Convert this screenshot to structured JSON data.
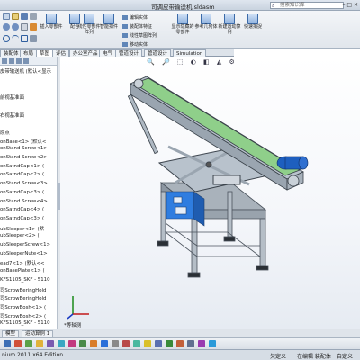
{
  "window": {
    "title": "司调皮带输送机.sldasm",
    "search_placeholder": "搜索知识库",
    "controls": "– □ ✕"
  },
  "ribbon": {
    "big_tools": [
      {
        "label": "插入零部件",
        "name": "insert-components"
      },
      {
        "label": "配合",
        "name": "mate"
      },
      {
        "label": "线性零部件阵列",
        "name": "linear-pattern"
      },
      {
        "label": "智能扣件",
        "name": "smart-fasteners"
      },
      {
        "label": "移动零部件",
        "name": "move-component"
      },
      {
        "label": "显示隐藏的零部件",
        "name": "show-hidden"
      },
      {
        "label": "装配体特征",
        "name": "assembly-features"
      },
      {
        "label": "参考几何体",
        "name": "reference-geometry"
      },
      {
        "label": "新建运动算例",
        "name": "new-motion-study"
      },
      {
        "label": "材料明细表",
        "name": "bill-of-materials"
      },
      {
        "label": "快速捕捉",
        "name": "instant-snap"
      }
    ],
    "small_tools": [
      "编辑实体",
      "装配体特征",
      "线性草图阵列",
      "移动实体"
    ]
  },
  "tabs": [
    "装配体",
    "布局",
    "草图",
    "评估",
    "办公室产品",
    "电气",
    "管道设计",
    "管道设计",
    "Simulation"
  ],
  "active_tab": 2,
  "feature_tree": {
    "items": [
      "皮带输送机 (默认<显示",
      "",
      "",
      "前视基准面",
      "",
      "右视基准面",
      "",
      "原点",
      "onBase<1> (默认<",
      "onStand Screw<1>",
      "onStand Screw<2>",
      "onSatndCap<1> (",
      "onSatndCap<2> (",
      "onStand Screw<3>",
      "onSatndCap<3> (",
      "onStand Screw<4>",
      "onSatndCap<4> (",
      "onSatndCap<3> (",
      "ubSleeper<1> (默",
      "ubSleeper<2> (",
      "ubSleeperScrew<1>",
      "ubSleeperNute<1>",
      "ead7<1> (默认<<",
      "onBasePlate<1> (",
      "KFS1105_SKF - 5110",
      "司ScrowBeringHold",
      "司ScrowBeringHold",
      "司ScrowBosh<1> (",
      "司ScrowBosh<2> (",
      "KFS1105_SKF - 5110"
    ]
  },
  "viewport": {
    "view_label": "*等轴测",
    "heads_up": "🔍 🔎 ⬚ ◐ ◧ ◭ ⚙"
  },
  "bottom_tabs": [
    "模型",
    "运动算例 1"
  ],
  "status": {
    "product": "nium 2011 x64 Edition",
    "state": "欠定义",
    "mode": "在编辑 装配体",
    "units": "自定义"
  },
  "colors": {
    "belt": "#8fcf8a",
    "frame": "#b8c2cc",
    "motor": "#1e5fbf",
    "blue_panel": "#2f7de0",
    "base": "#a9b2bb"
  }
}
